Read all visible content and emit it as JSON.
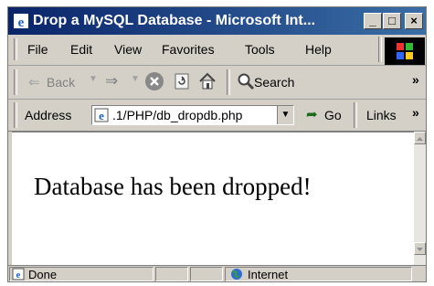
{
  "window": {
    "title": "Drop a MySQL Database - Microsoft Int..."
  },
  "controls": {
    "minimize": "_",
    "maximize": "□",
    "close": "×"
  },
  "menu": {
    "items": [
      "File",
      "Edit",
      "View",
      "Favorites",
      "Tools",
      "Help"
    ]
  },
  "toolbar": {
    "back_label": "Back",
    "search_label": "Search",
    "overflow": "»"
  },
  "address": {
    "label": "Address",
    "value": ".1/PHP/db_dropdb.php",
    "go_label": "Go",
    "links_label": "Links",
    "links_overflow": "»"
  },
  "content": {
    "message": "Database has been dropped!"
  },
  "status": {
    "text": "Done",
    "zone": "Internet"
  }
}
